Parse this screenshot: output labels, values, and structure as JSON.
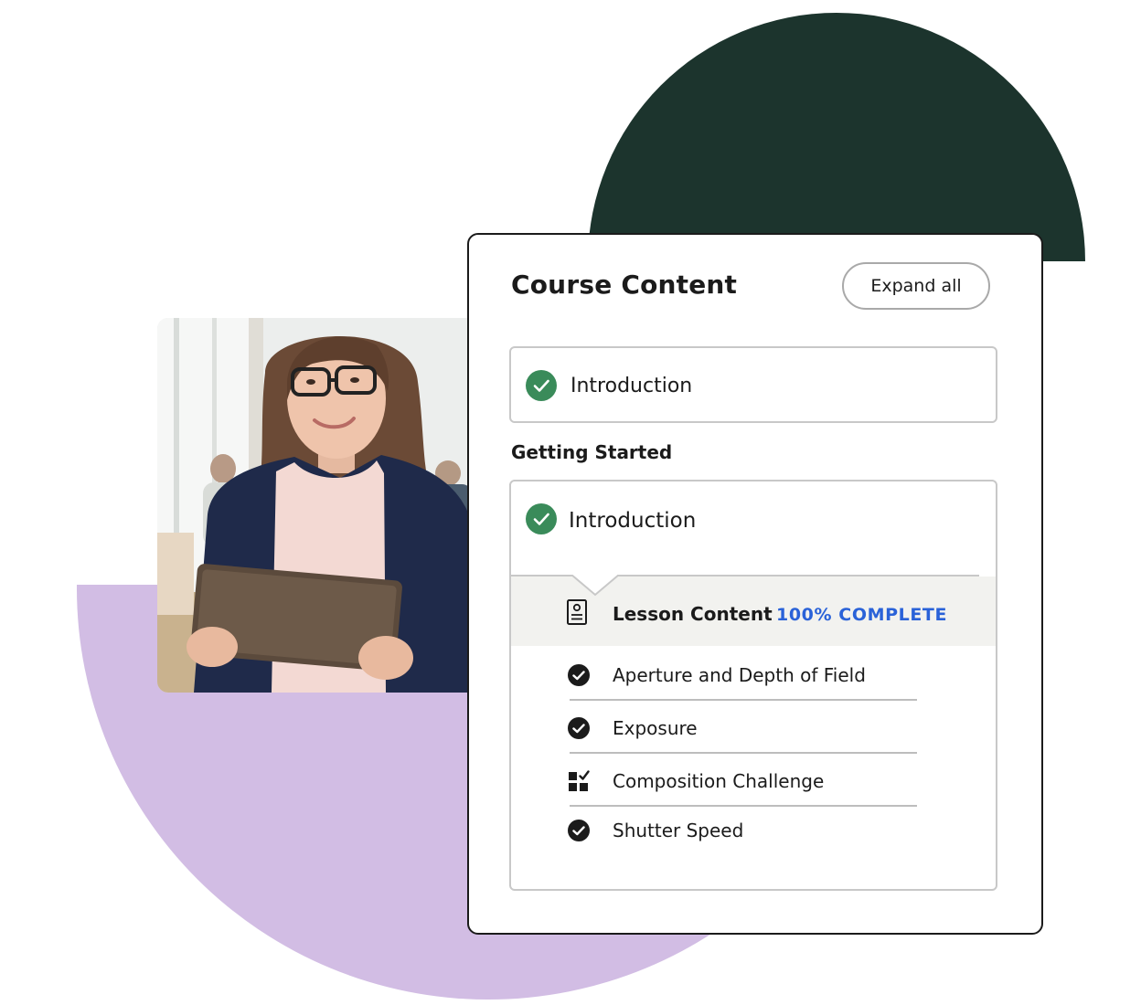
{
  "card": {
    "title": "Course Content",
    "expand_label": "Expand all"
  },
  "modules": [
    {
      "label": "Introduction",
      "status_icon": "green-check-circle-icon"
    }
  ],
  "section": {
    "heading": "Getting Started",
    "module": {
      "label": "Introduction",
      "status_icon": "green-check-circle-icon"
    },
    "lesson_content": {
      "title": "Lesson Content",
      "progress_label": "100% COMPLETE",
      "progress_percent": 100,
      "icon": "document-icon"
    },
    "lessons": [
      {
        "label": "Aperture and Depth of Field",
        "icon": "check-circle-icon"
      },
      {
        "label": "Exposure",
        "icon": "check-circle-icon"
      },
      {
        "label": "Composition Challenge",
        "icon": "quiz-grid-icon"
      },
      {
        "label": "Shutter Speed",
        "icon": "check-circle-icon"
      }
    ]
  },
  "colors": {
    "dark_green": "#1c342d",
    "lavender": "#d2bde4",
    "success_green": "#3a8b5a",
    "progress_blue": "#2a62d8",
    "text": "#1b1b1b"
  }
}
